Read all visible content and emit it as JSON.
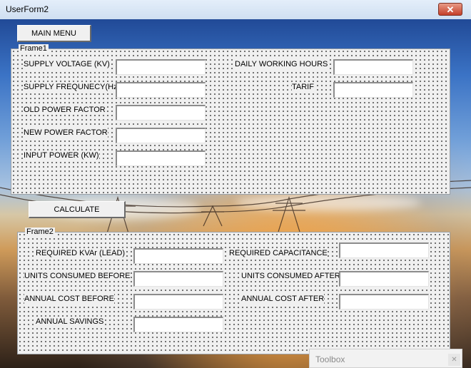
{
  "window": {
    "title": "UserForm2",
    "close_glyph": "✕"
  },
  "main_menu_label": "MAIN MENU",
  "calculate_label": "CALCULATE",
  "frame1": {
    "caption": "Frame1",
    "labels": {
      "supply_voltage": "SUPPLY VOLTAGE (KV)",
      "supply_frequency": "SUPPLY FREQUNECY(Hz)",
      "old_power_factor": "OLD POWER FACTOR",
      "new_power_factor": "NEW POWER FACTOR",
      "input_power": "INPUT POWER (KW)",
      "daily_working_hours": "DAILY WORKING HOURS",
      "tarif": "TARIF"
    },
    "values": {
      "supply_voltage": "",
      "supply_frequency": "",
      "old_power_factor": "",
      "new_power_factor": "",
      "input_power": "",
      "daily_working_hours": "",
      "tarif": ""
    }
  },
  "frame2": {
    "caption": "Frame2",
    "labels": {
      "required_kvar": "REQUIRED KVAr (LEAD)",
      "units_consumed_before": "UNITS CONSUMED BEFORE",
      "annual_cost_before": "ANNUAL COST BEFORE",
      "annual_savings": "ANNUAL SAVINGS",
      "required_capacitance": "REQUIRED CAPACITANCE",
      "units_consumed_after": "UNITS CONSUMED AFTER",
      "annual_cost_after": "ANNUAL COST AFTER"
    },
    "values": {
      "required_kvar": "",
      "units_consumed_before": "",
      "annual_cost_before": "",
      "annual_savings": "",
      "required_capacitance": "",
      "units_consumed_after": "",
      "annual_cost_after": ""
    }
  },
  "toolbox": {
    "title": "Toolbox",
    "close_glyph": "✕"
  },
  "colors": {
    "close_button": "#c4402a",
    "form_background": "#f0f0f0",
    "titlebar": "#dbe7f4"
  }
}
